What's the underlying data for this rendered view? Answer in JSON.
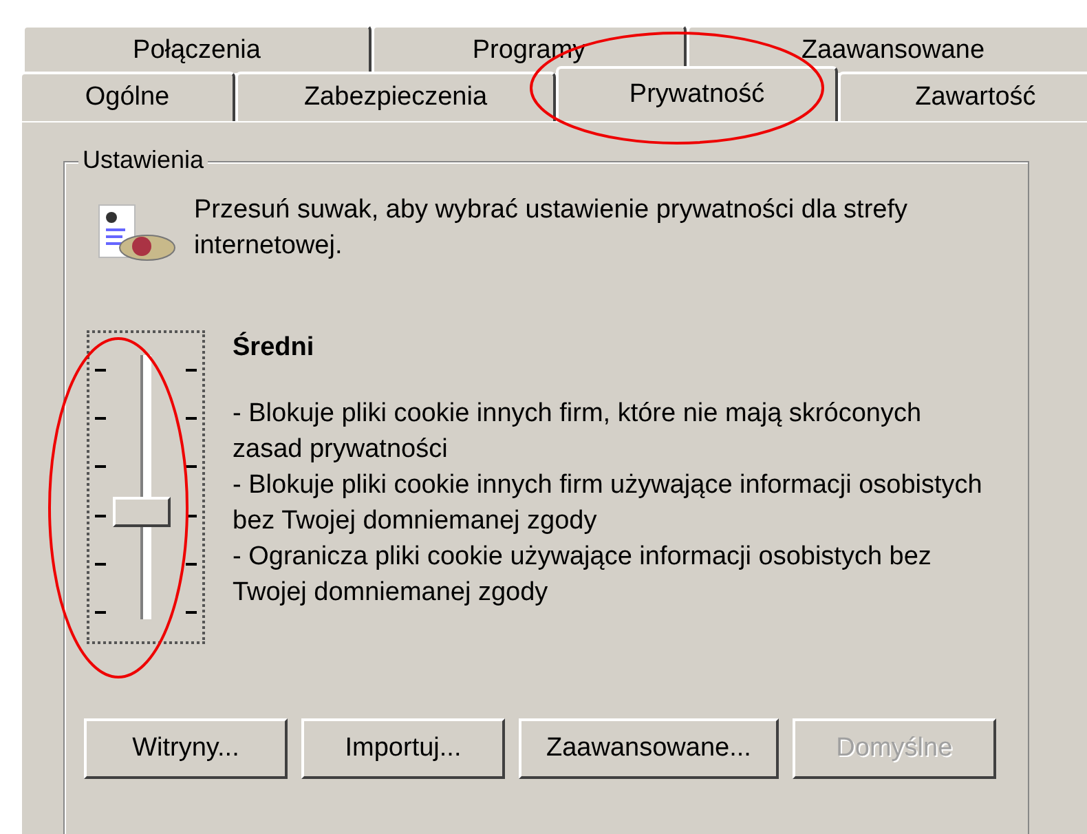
{
  "tabs_back_row": [
    {
      "label": "Połączenia",
      "selected": false
    },
    {
      "label": "Programy",
      "selected": false
    },
    {
      "label": "Zaawansowane",
      "selected": false
    }
  ],
  "tabs_front_row": [
    {
      "label": "Ogólne",
      "selected": false
    },
    {
      "label": "Zabezpieczenia",
      "selected": false
    },
    {
      "label": "Prywatność",
      "selected": true
    },
    {
      "label": "Zawartość",
      "selected": false
    }
  ],
  "settings_group": {
    "title": "Ustawienia",
    "description": "Przesuń suwak, aby wybrać ustawienie prywatności dla strefy internetowej.",
    "slider": {
      "level": 0.4
    },
    "level_name": "Średni",
    "level_details": [
      "- Blokuje pliki cookie innych firm, które nie mają skróconych zasad prywatności",
      "- Blokuje pliki cookie innych firm używające informacji osobistych bez Twojej domniemanej zgody",
      "- Ogranicza pliki cookie używające informacji osobistych bez Twojej domniemanej zgody"
    ],
    "buttons": [
      {
        "label": "Witryny...",
        "disabled": false
      },
      {
        "label": "Importuj...",
        "disabled": false
      },
      {
        "label": "Zaawansowane...",
        "disabled": false
      },
      {
        "label": "Domyślne",
        "disabled": true
      }
    ]
  }
}
